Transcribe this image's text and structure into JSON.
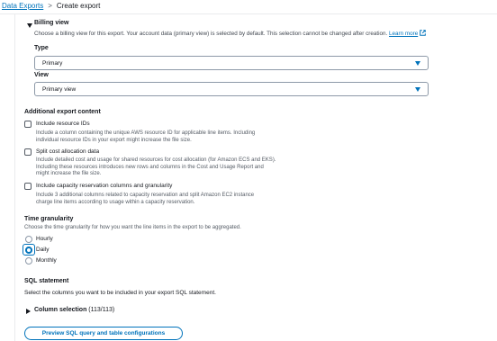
{
  "breadcrumb": {
    "root": "Data Exports",
    "separator": ">",
    "current": "Create export"
  },
  "billing_view": {
    "title": "Billing view",
    "description": "Choose a billing view for this export. Your account data (primary view) is selected by default. This selection cannot be changed after creation.",
    "learn_more": "Learn more",
    "type_label": "Type",
    "type_value": "Primary",
    "view_label": "View",
    "view_value": "Primary view"
  },
  "additional": {
    "title": "Additional export content",
    "items": [
      {
        "label": "Include resource IDs",
        "checked": false,
        "desc": [
          "Include a column containing the unique AWS resource ID for applicable line items. Including",
          "individual resource IDs in your export might increase the file size."
        ]
      },
      {
        "label": "Split cost allocation data",
        "checked": false,
        "desc": [
          "Include detailed cost and usage for shared resources for cost allocation (for Amazon ECS and EKS).",
          "Including these resources introduces new rows and columns in the Cost and Usage Report and",
          "might increase the file size."
        ]
      },
      {
        "label": "Include capacity reservation columns and granularity",
        "checked": false,
        "desc": [
          "Include 3 additional columns related to capacity reservation and split Amazon EC2 instance",
          "charge line items according to usage within a capacity reservation."
        ]
      }
    ]
  },
  "time_granularity": {
    "title": "Time granularity",
    "description": "Choose the time granularity for how you want the line items in the export to be aggregated.",
    "options": [
      "Hourly",
      "Daily",
      "Monthly"
    ],
    "selected": "Daily"
  },
  "sql": {
    "title": "SQL statement",
    "description": "Select the columns you want to be included in your export SQL statement.",
    "column_selection": "Column selection",
    "column_count": "(113/113)",
    "preview_button": "Preview SQL query and table configurations"
  },
  "colors": {
    "link": "#0073bb",
    "text": "#16191f",
    "muted": "#545b64",
    "border": "#8d99a8"
  }
}
